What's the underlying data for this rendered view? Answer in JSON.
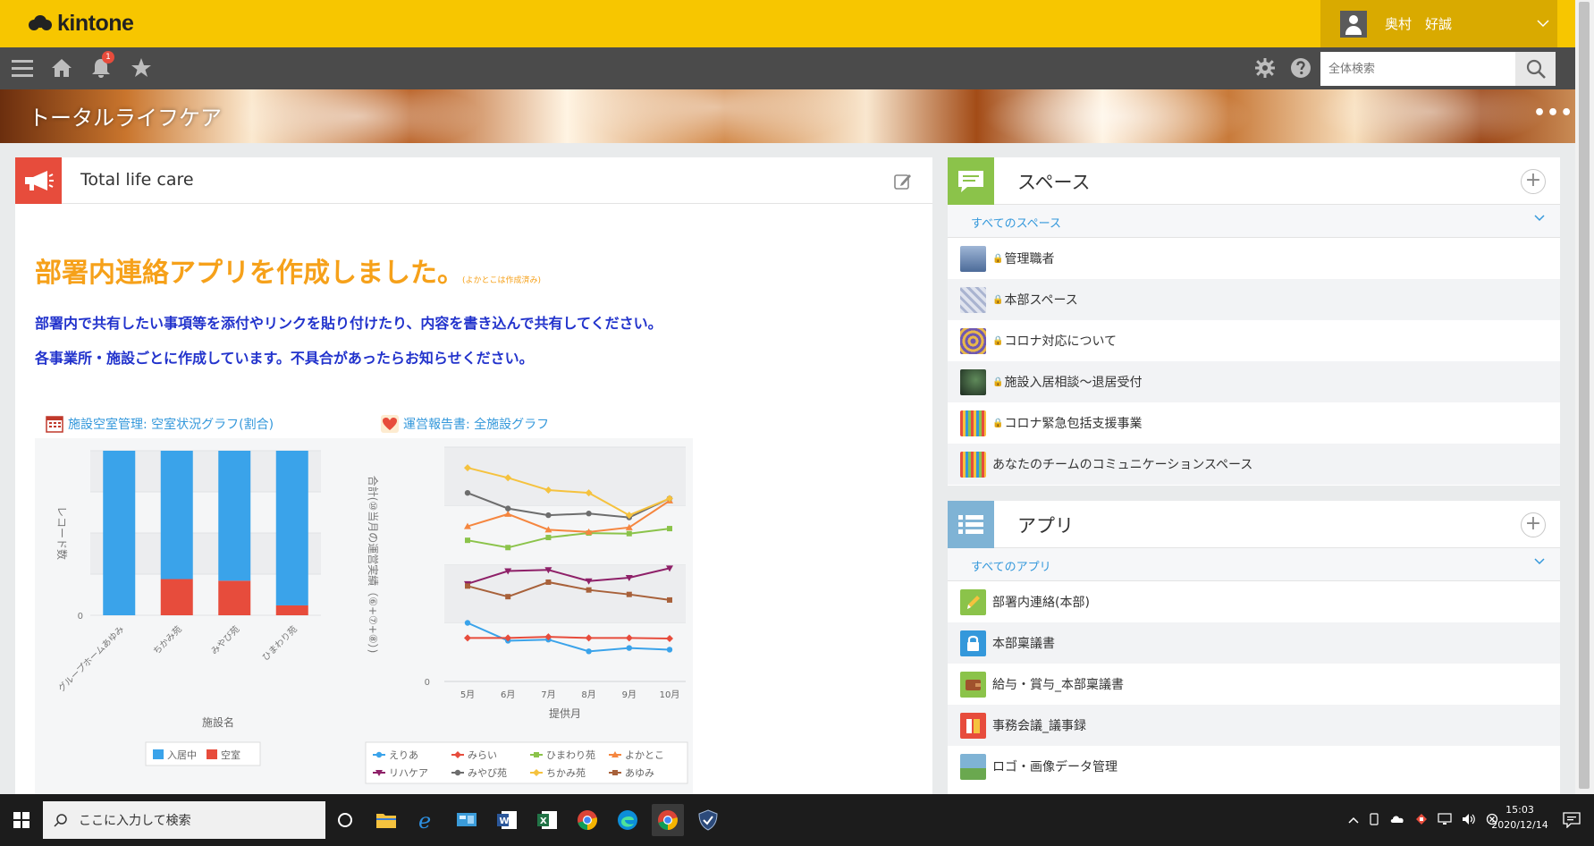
{
  "header": {
    "logo_text": "kintone",
    "user_name": "奥村　好誠"
  },
  "toolbar": {
    "notification_count": "1",
    "search_placeholder": "全体検索"
  },
  "space": {
    "title": "トータルライフケア",
    "menu_label": "•••"
  },
  "notice": {
    "title": "Total life care",
    "heading": "部署内連絡アプリを作成しました。",
    "heading_note": "(よかとこは作成済み)",
    "line1": "部署内で共有したい事項等を添付やリンクを貼り付けたり、内容を書き込んで共有してください。",
    "line2": "各事業所・施設ごとに作成しています。不具合があったらお知らせください。",
    "graph1_title": "施設空室管理: 空室状況グラフ(割合)",
    "graph2_title": "運営報告書: 全施設グラフ"
  },
  "chart_data": [
    {
      "type": "bar",
      "stacked": true,
      "categories": [
        "グループホームあゆみ",
        "ちかみ苑",
        "みやび苑",
        "ひまわり苑"
      ],
      "series": [
        {
          "name": "入居中",
          "color": "#3aa3ea",
          "values": [
            100,
            78,
            79,
            94
          ]
        },
        {
          "name": "空室",
          "color": "#e74c3c",
          "values": [
            0,
            22,
            21,
            6
          ]
        }
      ],
      "xlabel": "施設名",
      "ylabel": "レコード数",
      "y_zero_label": "0",
      "ylim": [
        0,
        100
      ],
      "legend": "bottom"
    },
    {
      "type": "line",
      "x": [
        "5月",
        "6月",
        "7月",
        "8月",
        "9月",
        "10月"
      ],
      "series": [
        {
          "name": "えりあ",
          "color": "#3aa3ea",
          "marker": "circle",
          "values": [
            1050,
            730,
            750,
            540,
            600,
            570
          ]
        },
        {
          "name": "みらい",
          "color": "#e74c3c",
          "marker": "diamond",
          "values": [
            780,
            780,
            800,
            780,
            780,
            770
          ]
        },
        {
          "name": "ひまわり苑",
          "color": "#8bc34a",
          "marker": "square",
          "values": [
            2530,
            2400,
            2580,
            2660,
            2650,
            2740
          ]
        },
        {
          "name": "よかとこ",
          "color": "#f5863f",
          "marker": "triangle",
          "values": [
            2780,
            3000,
            2720,
            2680,
            2760,
            3240
          ]
        },
        {
          "name": "リハケア",
          "color": "#8e2068",
          "marker": "triangle-down",
          "values": [
            1750,
            1980,
            2000,
            1800,
            1860,
            2030
          ]
        },
        {
          "name": "みやび苑",
          "color": "#6d6d6d",
          "marker": "circle",
          "values": [
            3380,
            3100,
            2980,
            3010,
            2940,
            3280
          ]
        },
        {
          "name": "ちかみ苑",
          "color": "#f5c23e",
          "marker": "diamond",
          "values": [
            3830,
            3650,
            3430,
            3380,
            2980,
            3280
          ]
        },
        {
          "name": "あゆみ",
          "color": "#a8613a",
          "marker": "square",
          "values": [
            1710,
            1520,
            1780,
            1640,
            1560,
            1460
          ]
        }
      ],
      "xlabel": "提供月",
      "ylabel": "合計(⑩当月の運営実績（⑥+⑦+⑧）)",
      "y_zero_label": "0",
      "ylim": [
        0,
        4200
      ],
      "legend": "bottom"
    }
  ],
  "spaces": {
    "title": "スペース",
    "filter": "すべてのスペース",
    "items": [
      {
        "label": "管理職者",
        "locked": true,
        "thumb": "#7a93b8"
      },
      {
        "label": "本部スペース",
        "locked": true,
        "thumb": "#c7cfe0"
      },
      {
        "label": "コロナ対応について",
        "locked": true,
        "thumb": "#6f5aa8"
      },
      {
        "label": "施設入居相談～退居受付",
        "locked": true,
        "thumb": "#2f3a33"
      },
      {
        "label": "コロナ緊急包括支援事業",
        "locked": true,
        "thumb": "#c46a4a"
      },
      {
        "label": "あなたのチームのコミュニケーションスペース",
        "locked": false,
        "thumb": "#c46a4a"
      }
    ]
  },
  "apps": {
    "title": "アプリ",
    "filter": "すべてのアプリ",
    "items": [
      {
        "label": "部署内連絡(本部)",
        "color": "#8bc34a",
        "icon": "pencil-icon"
      },
      {
        "label": "本部稟議書",
        "color": "#3498db",
        "icon": "lock-icon"
      },
      {
        "label": "給与・賞与_本部稟議書",
        "color": "#8bc34a",
        "icon": "wallet-icon"
      },
      {
        "label": "事務会議_議事録",
        "color": "#e74c3c",
        "icon": "book-icon"
      },
      {
        "label": "ロゴ・画像データ管理",
        "color": "#7fb3d5",
        "icon": "image-icon"
      }
    ]
  },
  "taskbar": {
    "search_placeholder": "ここに入力して検索",
    "time": "15:03",
    "date": "2020/12/14"
  }
}
